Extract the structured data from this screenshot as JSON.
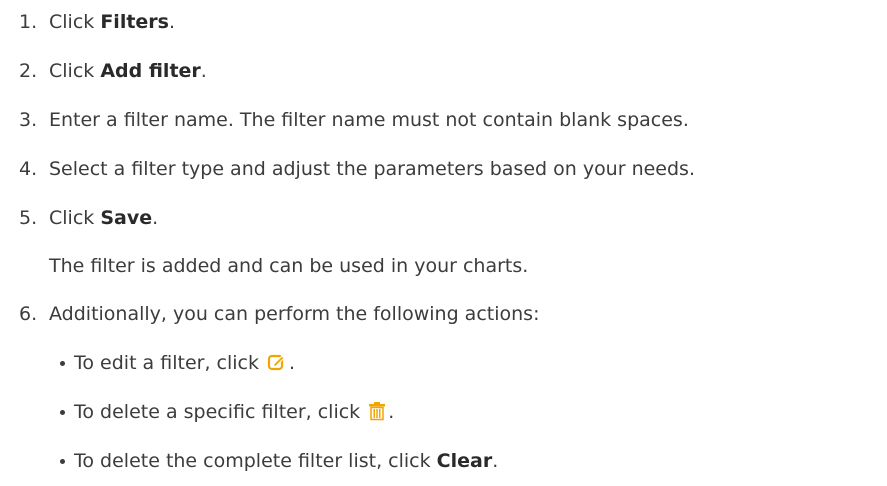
{
  "steps": [
    {
      "num": "1.",
      "pre": "Click ",
      "bold": "Filters",
      "post": "."
    },
    {
      "num": "2.",
      "pre": "Click ",
      "bold": "Add filter",
      "post": "."
    },
    {
      "num": "3.",
      "text": "Enter a filter name. The filter name must not contain blank spaces."
    },
    {
      "num": "4.",
      "text": "Select a filter type and adjust the parameters based on your needs."
    },
    {
      "num": "5.",
      "pre": "Click ",
      "bold": "Save",
      "post": "."
    },
    {
      "num": "6.",
      "text": "Additionally, you can perform the following actions:"
    }
  ],
  "step5_note": "The filter is added and can be used in your charts.",
  "actions": [
    {
      "pre": "To edit a filter, click ",
      "icon": "edit-icon",
      "post": "."
    },
    {
      "pre": "To delete a specific filter, click ",
      "icon": "trash-icon",
      "post": "."
    },
    {
      "pre": "To delete the complete filter list, click ",
      "bold": "Clear",
      "post": "."
    }
  ],
  "colors": {
    "text": "#3c3c3c",
    "icon": "#f0a500"
  }
}
